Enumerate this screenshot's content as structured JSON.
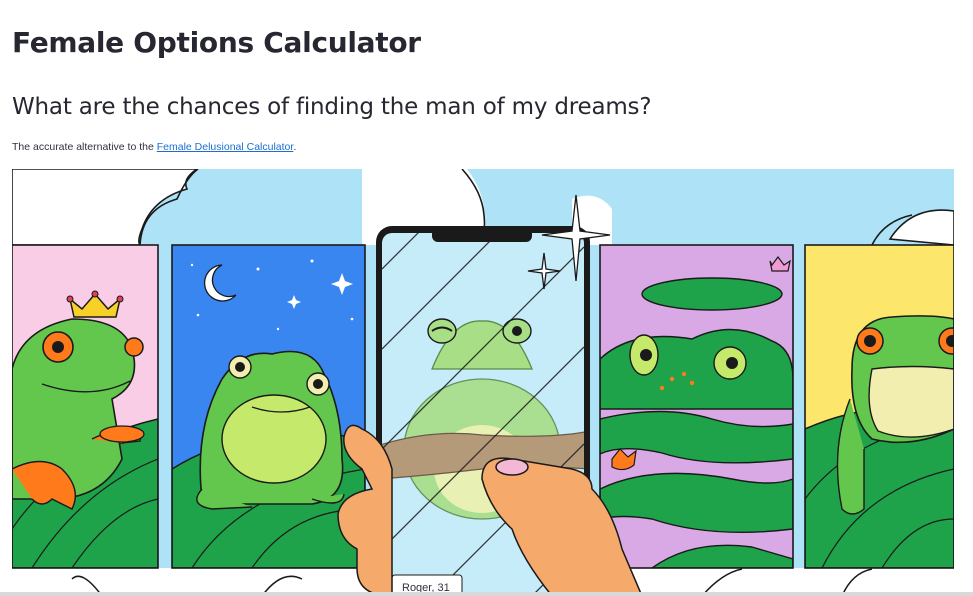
{
  "page": {
    "title": "Female Options Calculator",
    "subtitle": "What are the chances of finding the man of my dreams?",
    "caption_prefix": "The accurate alternative to the ",
    "caption_link": "Female Delusional Calculator",
    "caption_suffix": "."
  },
  "hero": {
    "profile_label": "Roger, 31",
    "colors": {
      "sky": "#aee3f7",
      "pink": "#f9cde6",
      "night": "#3a86f0",
      "lilac": "#d9a9e6",
      "yellow": "#fce66c",
      "frog_green": "#63c74d",
      "leaf_green": "#1ea24a",
      "belly": "#f1eeb0",
      "orange": "#ff7a1a",
      "crown": "#f7d028"
    }
  }
}
